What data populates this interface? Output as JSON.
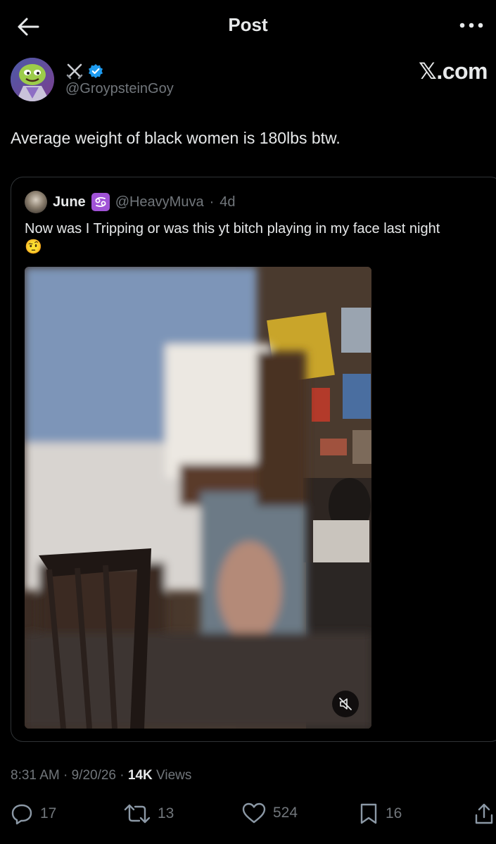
{
  "header": {
    "title": "Post"
  },
  "watermark": "𝕏.com",
  "author": {
    "display_name_icon": "crossed-swords",
    "verified": true,
    "handle": "@GroypsteinGoy"
  },
  "tweet": {
    "text": "Average weight of black women is 180lbs btw."
  },
  "quote": {
    "name": "June",
    "zodiac_icon": "cancer-sign",
    "handle": "@HeavyMuva",
    "separator": "·",
    "age": "4d",
    "text": "Now was I Tripping or was this yt bitch playing in my face last night",
    "emoji": "🤨",
    "media_type": "video",
    "muted": true
  },
  "meta": {
    "time": "8:31 AM",
    "dot1": "·",
    "date": "9/20/26",
    "dot2": "·",
    "views": "14K",
    "views_label": "Views"
  },
  "actions": {
    "replies": "17",
    "reposts": "13",
    "likes": "524",
    "bookmarks": "16"
  },
  "colors": {
    "background": "#000000",
    "text_primary": "#e7e9ea",
    "text_secondary": "#71767b",
    "verified_blue": "#1d9bf0",
    "border": "#2f3336",
    "zodiac_purple": "#a052d6"
  }
}
